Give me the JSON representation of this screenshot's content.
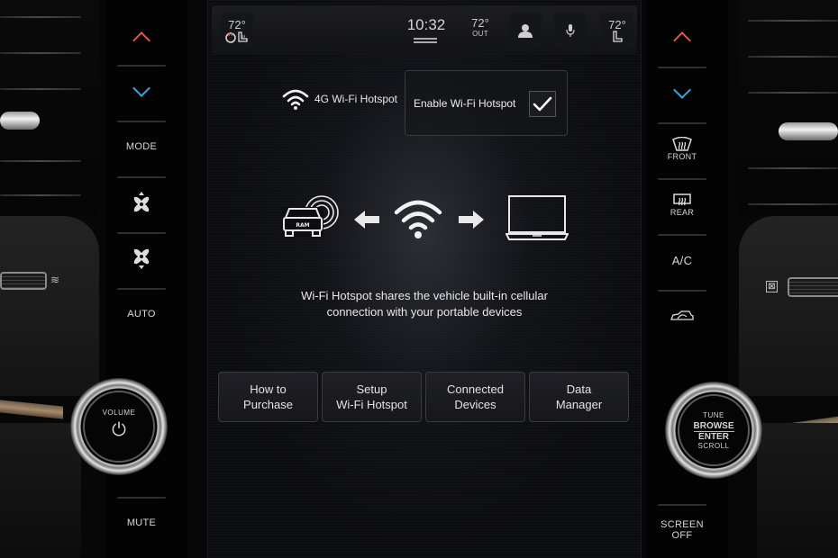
{
  "status_bar": {
    "driver_temp": "72°",
    "clock": "10:32",
    "outside_temp": "72°",
    "outside_label": "OUT",
    "passenger_temp": "72°",
    "icons": {
      "driver_seat": "heated-seat-icon",
      "profile": "user-icon",
      "voice": "microphone-icon",
      "passenger_seat": "seat-icon"
    }
  },
  "hotspot": {
    "title": "4G Wi-Fi Hotspot",
    "title_icon": "wifi-icon",
    "enable_label": "Enable Wi-Fi Hotspot",
    "enabled": true,
    "description_line1": "Wi-Fi Hotspot shares the vehicle built-in cellular",
    "description_line2": "connection with your portable devices",
    "diagram_icons": [
      "truck-signal-icon",
      "arrow-left-icon",
      "wifi-icon",
      "arrow-right-icon",
      "laptop-icon"
    ]
  },
  "menu": [
    {
      "line1": "How to",
      "line2": "Purchase"
    },
    {
      "line1": "Setup",
      "line2": "Wi-Fi Hotspot"
    },
    {
      "line1": "Connected",
      "line2": "Devices"
    },
    {
      "line1": "Data",
      "line2": "Manager"
    }
  ],
  "left_controls": {
    "temp_up": "chevron-up-icon",
    "temp_down": "chevron-down-icon",
    "mode": "MODE",
    "fan_up": "fan-up-icon",
    "fan_down": "fan-down-icon",
    "auto": "AUTO",
    "volume_knob_label": "VOLUME",
    "power_icon": "power-icon",
    "mute": "MUTE"
  },
  "right_controls": {
    "temp_up": "chevron-up-icon",
    "temp_down": "chevron-down-icon",
    "front_defrost": "FRONT",
    "rear_defrost": "REAR",
    "ac": "A/C",
    "recirculate_icon": "recirculate-icon",
    "knob_tune": "TUNE",
    "knob_browse": "BROWSE",
    "knob_enter": "ENTER",
    "knob_scroll": "SCROLL",
    "screen_off_line1": "SCREEN",
    "screen_off_line2": "OFF"
  },
  "colors": {
    "temp_up_accent": "#e2584a",
    "temp_down_accent": "#3aa8e6",
    "screen_bg": "#0b0c10",
    "trim": "#a58a6c"
  }
}
